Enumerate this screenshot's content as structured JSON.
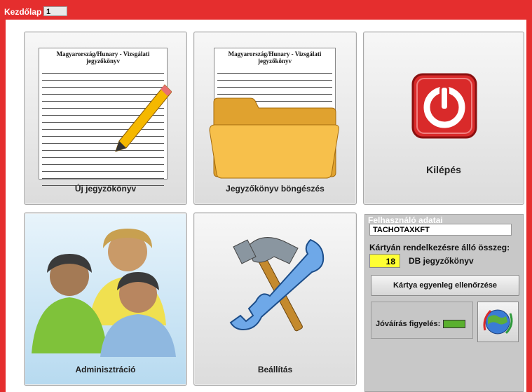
{
  "window": {
    "title": "Kezdőlap",
    "page_number": "1"
  },
  "tiles": {
    "new_report": "Új jegyzőkönyv",
    "browse": "Jegyzőkönyv böngészés",
    "exit": "Kilépés",
    "admin": "Adminisztráció",
    "settings": "Beállítás"
  },
  "document_thumbnail": {
    "title": "Magyarország/Hunary - Vizsgálati jegyzőkönyv"
  },
  "user_panel": {
    "title": "Felhasználó adatai",
    "username": "TACHOTAXKFT",
    "balance_label": "Kártyán rendelkezésre álló összeg:",
    "balance_count": "18",
    "balance_unit": "DB jegyzőkönyv",
    "check_button": "Kártya egyenleg ellenőrzése",
    "credit_label": "Jóváírás figyelés:",
    "credit_status_color": "#5ab02e"
  },
  "colors": {
    "frame": "#e52e2e",
    "exit_icon": "#d92a2a",
    "balance_highlight": "#ffff33"
  }
}
